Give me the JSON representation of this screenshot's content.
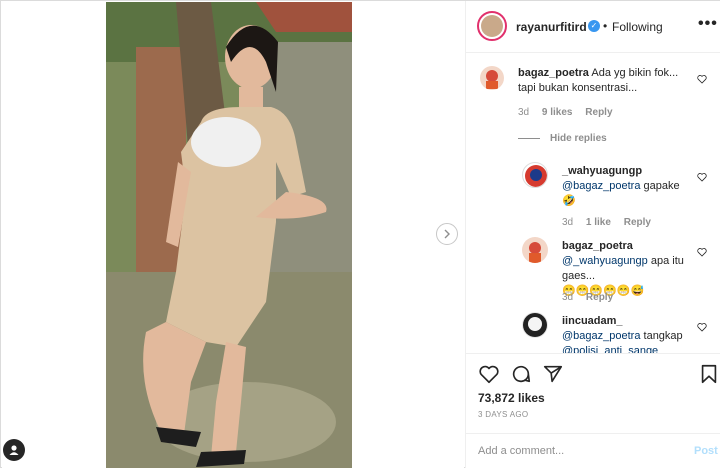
{
  "header": {
    "username": "rayanurfitird",
    "separator": "•",
    "follow_status": "Following",
    "more_label": "•••"
  },
  "comments": [
    {
      "username": "bagaz_poetra",
      "text": "Ada yg bikin fok... tapi bukan konsentrasi...",
      "age": "3d",
      "likes": "9 likes",
      "reply": "Reply"
    }
  ],
  "hide_replies": "Hide replies",
  "replies": [
    {
      "username": "_wahyuagungp",
      "mention": "@bagaz_poetra",
      "text": "gapake",
      "emoji": "🤣",
      "age": "3d",
      "likes": "1 like",
      "reply": "Reply"
    },
    {
      "username": "bagaz_poetra",
      "mention": "@_wahyuagungp",
      "text": "apa itu gaes...",
      "emoji": "😁😁😁😁😁😅",
      "age": "3d",
      "reply": "Reply"
    },
    {
      "username": "iincuadam_",
      "mention": "@bagaz_poetra",
      "text": "tangkap",
      "mention2": "@polisi_anti_sange"
    }
  ],
  "actions": {
    "likes": "73,872 likes",
    "date": "3 DAYS AGO"
  },
  "composer": {
    "placeholder": "Add a comment...",
    "post_label": "Post"
  },
  "icons": [
    "heart-icon",
    "comment-icon",
    "share-icon",
    "bookmark-icon",
    "verified-icon",
    "chevron-right-icon",
    "user-icon"
  ],
  "colors": {
    "link": "#00376b",
    "verified": "#3897f0",
    "muted": "#8e8e8e",
    "post_disabled": "#b2dffc"
  }
}
